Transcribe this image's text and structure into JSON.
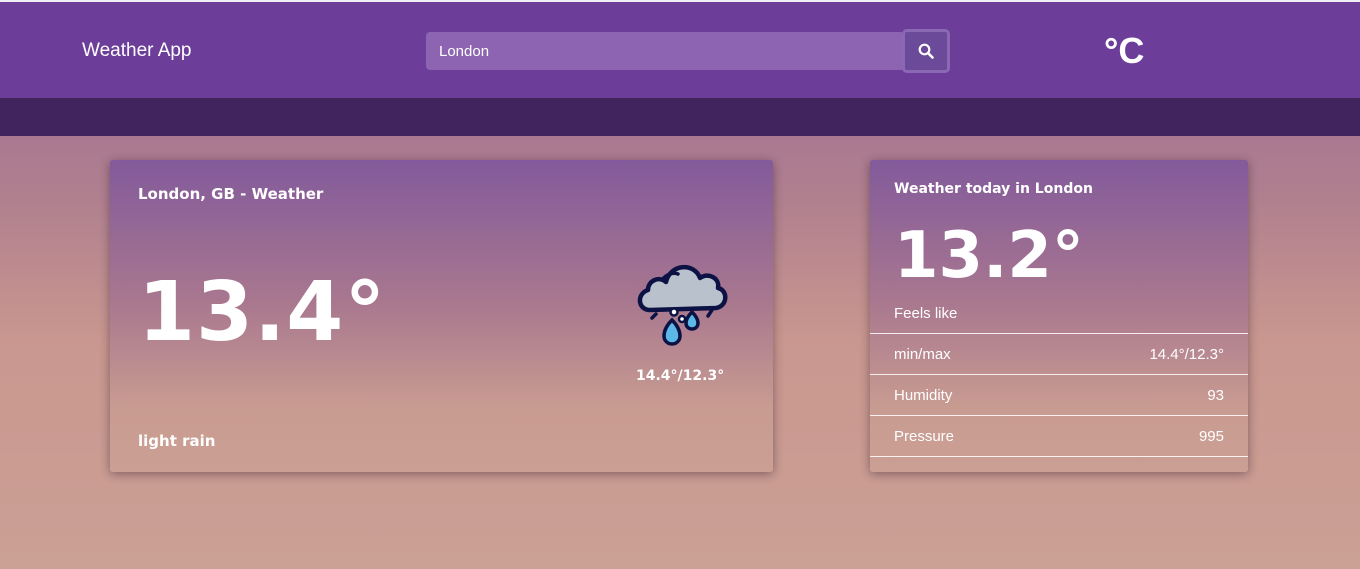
{
  "navbar": {
    "brand": "Weather App",
    "search": {
      "value": "London",
      "placeholder": ""
    },
    "search_icon": "magnifier-icon",
    "unit_label": "°C"
  },
  "main_card": {
    "title": "London, GB - Weather",
    "temperature": "13.4°",
    "description": "light rain",
    "icon": "rain-cloud-icon",
    "minmax": "14.4°/12.3°"
  },
  "side_card": {
    "title": "Weather today in London",
    "feels_like_value": "13.2°",
    "feels_like_label": "Feels like",
    "rows": [
      {
        "label": "min/max",
        "value": "14.4°/12.3°"
      },
      {
        "label": "Humidity",
        "value": "93"
      },
      {
        "label": "Pressure",
        "value": "995"
      }
    ]
  },
  "colors": {
    "navbar": "#6c3e99",
    "subbar": "#41245e",
    "search_bg": "#8c64b1",
    "background_bottom": "#cba095"
  }
}
